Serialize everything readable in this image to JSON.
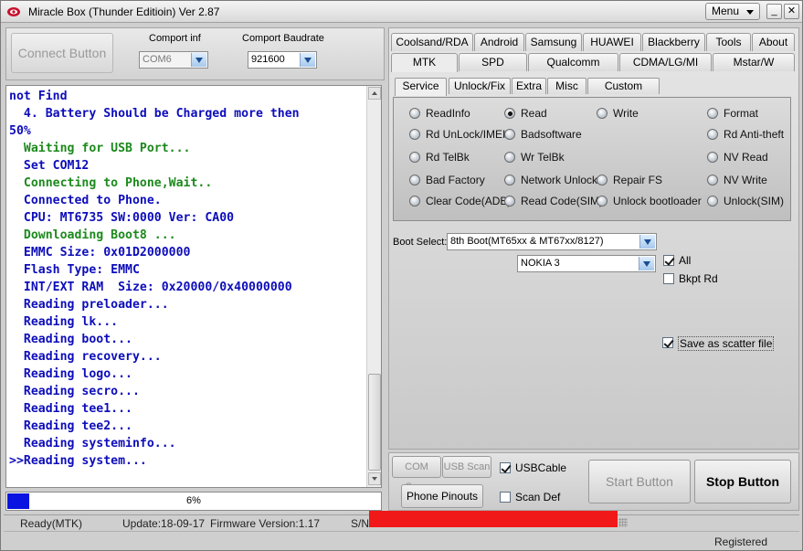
{
  "window": {
    "title": "Miracle Box (Thunder Editioin) Ver 2.87",
    "menu_label": "Menu",
    "minimize": "_",
    "restore": "□",
    "close": "✕"
  },
  "connect": {
    "button_label": "Connect Button",
    "comport_label": "Comport inf",
    "comport_value": "COM6",
    "baud_label": "Comport Baudrate",
    "baud_value": "921600"
  },
  "log": {
    "lines": [
      {
        "text": "not Find",
        "color": "blue"
      },
      {
        "text": "  4. Battery Should be Charged more then",
        "color": "blue"
      },
      {
        "text": "50%",
        "color": "blue"
      },
      {
        "text": "  Waiting for USB Port...",
        "color": "green"
      },
      {
        "text": "  Set COM12",
        "color": "blue"
      },
      {
        "text": "  Connecting to Phone,Wait..",
        "color": "green"
      },
      {
        "text": "  Connected to Phone.",
        "color": "blue"
      },
      {
        "text": "  CPU: MT6735 SW:0000 Ver: CA00",
        "color": "blue"
      },
      {
        "text": "  Downloading Boot8 ...",
        "color": "green"
      },
      {
        "text": "  EMMC Size: 0x01D2000000",
        "color": "blue"
      },
      {
        "text": "  Flash Type: EMMC",
        "color": "blue"
      },
      {
        "text": "  INT/EXT RAM  Size: 0x20000/0x40000000",
        "color": "blue"
      },
      {
        "text": "  Reading preloader...",
        "color": "blue"
      },
      {
        "text": "  Reading lk...",
        "color": "blue"
      },
      {
        "text": "  Reading boot...",
        "color": "blue"
      },
      {
        "text": "  Reading recovery...",
        "color": "blue"
      },
      {
        "text": "  Reading logo...",
        "color": "blue"
      },
      {
        "text": "  Reading secro...",
        "color": "blue"
      },
      {
        "text": "  Reading tee1...",
        "color": "blue"
      },
      {
        "text": "  Reading tee2...",
        "color": "blue"
      },
      {
        "text": "  Reading systeminfo...",
        "color": "blue"
      },
      {
        "text": ">>Reading system...",
        "color": "blue"
      }
    ]
  },
  "progress": {
    "percent": 6,
    "label": "6%"
  },
  "status": {
    "mode": "Ready(MTK)",
    "update": "Update:18-09-17",
    "firmware": "Firmware Version:1.17",
    "sn_label": "S/N:",
    "registered": "Registered"
  },
  "tabs_row1": [
    "Coolsand/RDA",
    "Android",
    "Samsung",
    "HUAWEI",
    "Blackberry",
    "Tools",
    "About"
  ],
  "tabs_row2": [
    "MTK",
    "SPD",
    "Qualcomm",
    "CDMA/LG/MI",
    "Mstar/W"
  ],
  "active_tab": "MTK",
  "subtabs": [
    "Service",
    "Unlock/Fix",
    "Extra",
    "Misc",
    "Custom Setting"
  ],
  "active_subtab": "Service",
  "radios": [
    "ReadInfo",
    "Read",
    "Write",
    "Format",
    "Rd UnLock/IMEI",
    "Badsoftware",
    "Rd Anti-theft",
    "Rd TelBk",
    "Wr TelBk",
    "NV Read",
    "Bad Factory",
    "Network Unlock",
    "Repair FS",
    "NV Write",
    "Clear Code(ADB)",
    "Read Code(SIM)",
    "Unlock bootloader",
    "Unlock(SIM)"
  ],
  "selected_radio": "Read",
  "boot": {
    "label": "Boot Select:",
    "value": "8th Boot(MT65xx & MT67xx/8127)",
    "model": "NOKIA 3"
  },
  "options": {
    "all": "All",
    "bkpt": "Bkpt Rd",
    "scatter": "Save as scatter file",
    "all_checked": true,
    "bkpt_checked": false,
    "scatter_checked": true
  },
  "controls": {
    "com_scan": "COM Scan",
    "usb_scan": "USB Scan",
    "usb_cable": "USBCable",
    "usb_cable_checked": true,
    "phone_pinouts": "Phone Pinouts",
    "scan_def": "Scan Def",
    "scan_def_checked": false,
    "start": "Start Button",
    "stop": "Stop Button"
  },
  "colors": {
    "log_blue": "#0d0dbb",
    "log_green": "#1c8a1c",
    "progress": "#0a14e0",
    "redaction": "#f01818"
  }
}
